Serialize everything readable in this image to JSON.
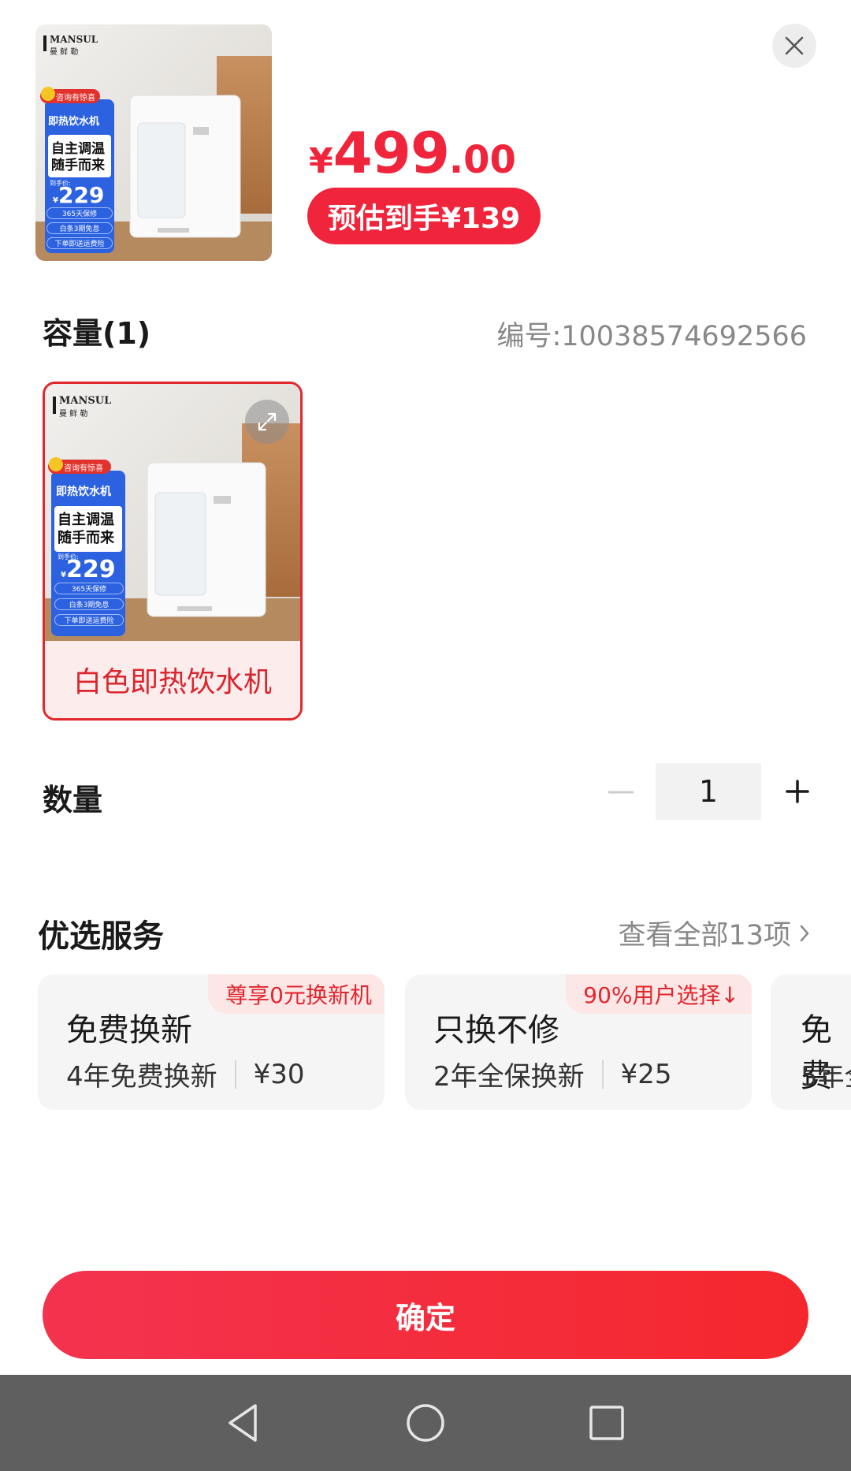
{
  "product": {
    "price_symbol": "¥",
    "price_int": "499",
    "price_dec": ".00",
    "estimate_label": "预估到手¥139",
    "image_brand": "MANSUL",
    "image_brand_cn": "曼 鲜 勒",
    "image_promo_tag": "咨询有惊喜",
    "image_title": "即热饮水机",
    "image_slogan_1": "自主调温",
    "image_slogan_2": "随手而来",
    "image_price_label": "到手价:",
    "image_price_symbol": "¥",
    "image_price": "229",
    "image_perk_1": "365天保修",
    "image_perk_2": "白条3期免息",
    "image_perk_3": "下单即送运费险"
  },
  "spec": {
    "title": "容量(1)",
    "serial": "编号:10038574692566",
    "variant_label": "白色即热饮水机"
  },
  "quantity": {
    "title": "数量",
    "value": "1"
  },
  "services": {
    "title": "优选服务",
    "view_all": "查看全部13项",
    "items": [
      {
        "tag": "尊享0元换新机",
        "name": "免费换新",
        "desc": "4年免费换新",
        "price": "¥30"
      },
      {
        "tag": "90%用户选择↓",
        "name": "只换不修",
        "desc": "2年全保换新",
        "price": "¥25"
      },
      {
        "tag": "",
        "name": "免费",
        "desc": "5年全",
        "price": ""
      }
    ]
  },
  "confirm_label": "确定",
  "colors": {
    "accent": "#f0243b",
    "tag_bg": "#fce6e6",
    "navbar": "#5f5f5f"
  }
}
